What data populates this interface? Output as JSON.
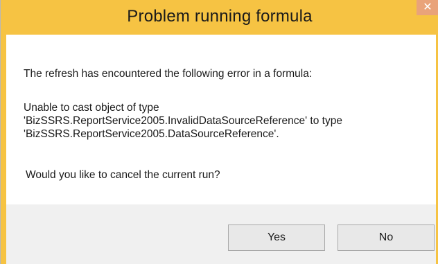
{
  "dialog": {
    "title": "Problem running formula",
    "close_icon": "close-icon",
    "messages": {
      "line1": "The refresh has encountered the following error in a formula:",
      "line2": "Unable to cast object of type",
      "line3": "'BizSSRS.ReportService2005.InvalidDataSourceReference' to type",
      "line4": "'BizSSRS.ReportService2005.DataSourceReference'.",
      "line5": "Would you like to cancel the current run?"
    },
    "buttons": {
      "yes": "Yes",
      "no": "No"
    },
    "colors": {
      "title_bar": "#f6c343",
      "close_button": "#e9a37a",
      "content_bg": "#ffffff",
      "footer_bg": "#f0f0f0"
    }
  }
}
